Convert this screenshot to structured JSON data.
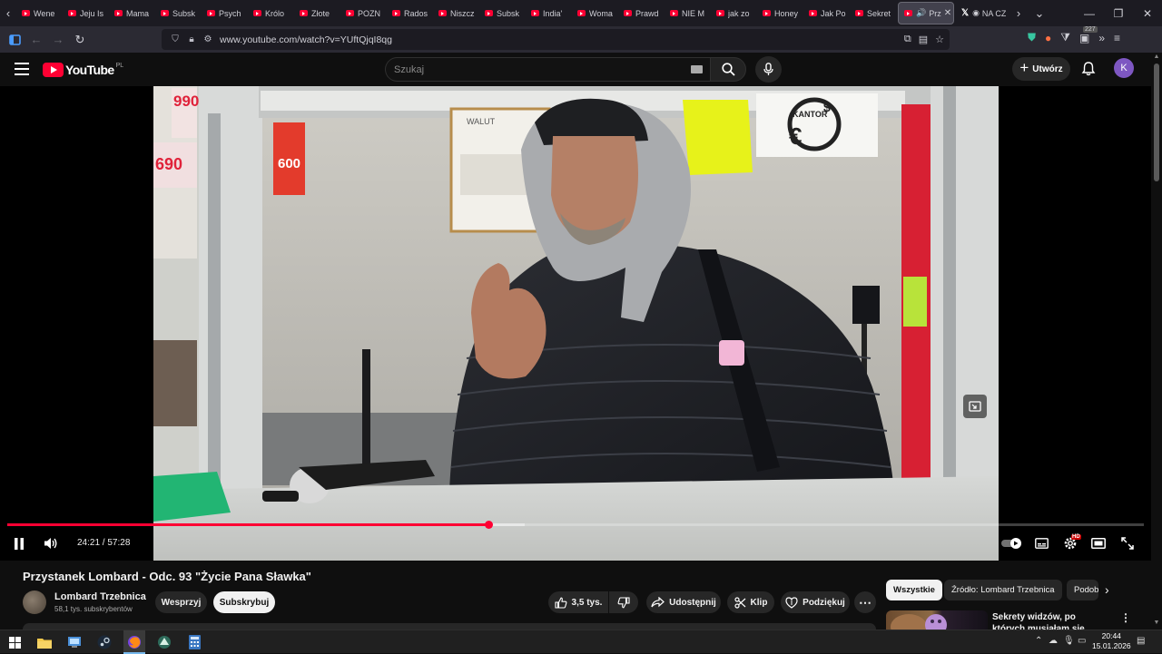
{
  "browser": {
    "tabs": [
      {
        "label": "Wenе"
      },
      {
        "label": "Jeju Is"
      },
      {
        "label": "Mama"
      },
      {
        "label": "Subsk"
      },
      {
        "label": "Psych"
      },
      {
        "label": "Królo"
      },
      {
        "label": "Złote"
      },
      {
        "label": "POZN"
      },
      {
        "label": "Rados"
      },
      {
        "label": "Niszcz"
      },
      {
        "label": "Subsk"
      },
      {
        "label": "India'"
      },
      {
        "label": "Woma"
      },
      {
        "label": "Prawd"
      },
      {
        "label": "NIE M"
      },
      {
        "label": "jak zo"
      },
      {
        "label": "Honey"
      },
      {
        "label": "Jak Po"
      },
      {
        "label": "Sekret"
      }
    ],
    "active_tab": {
      "label": "Prz"
    },
    "x_tab": {
      "label": "NA CZ"
    },
    "url": "www.youtube.com/watch?v=YUftQjqI8qg",
    "extension_badge": "227"
  },
  "youtube": {
    "logo_text": "YouTube",
    "country_code": "PL",
    "search_placeholder": "Szukaj",
    "create_label": "Utwórz",
    "avatar_letter": "K",
    "avatar_color": "#7e57c2"
  },
  "player": {
    "current_time": "24:21",
    "duration": "57:28",
    "time_display": "24:21 / 57:28",
    "progress_fraction": 0.4237,
    "loaded_fraction": 0.455,
    "hd_badge": "HD",
    "state": "playing"
  },
  "video": {
    "title": "Przystanek Lombard - Odc. 93 \"Życie Pana Sławka\"",
    "channel_name": "Lombard Trzebnica",
    "subscribers": "58,1 tys. subskrybentów",
    "join_label": "Wesprzyj",
    "subscribe_label": "Subskrybuj",
    "likes": "3,5 tys.",
    "share_label": "Udostępnij",
    "clip_label": "Klip",
    "thanks_label": "Podziękuj"
  },
  "scene": {
    "sign_walut": "WALUT",
    "sign_kantor": "KANTOR",
    "sign_euro": "€",
    "sign_dollar": "$",
    "price_990": "990",
    "price_690": "690",
    "price_600": "600"
  },
  "sidebar": {
    "chips": [
      {
        "label": "Wszystkie"
      },
      {
        "label": "Źródło: Lombard Trzebnica"
      },
      {
        "label": "Podob"
      }
    ],
    "recommendation": {
      "title": "Sekrety widzów, po których musiałam się położyć"
    }
  },
  "taskbar": {
    "time": "20:44",
    "date": "15.01.2026"
  },
  "colors": {
    "youtube_red": "#ff0033",
    "background": "#0f0f0f",
    "browser_toolbar": "#2b2a33"
  }
}
